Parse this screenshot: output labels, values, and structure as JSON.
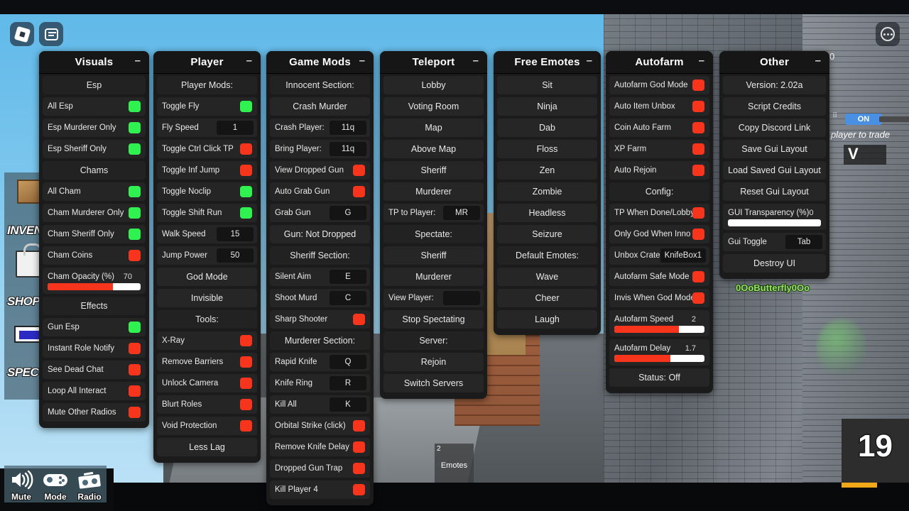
{
  "topbar": {
    "roblox_icon": "roblox-logo-icon",
    "chat_icon": "chat-icon",
    "menu_icon": "more-options-icon"
  },
  "side_menu": [
    {
      "label": "INVENTORY",
      "icon": "crate-icon"
    },
    {
      "label": "SHOP",
      "icon": "shopping-bag-icon"
    },
    {
      "label": "SPECTATE",
      "icon": "screen-icon"
    }
  ],
  "bottom_controls": [
    {
      "label": "Mute",
      "icon": "speaker-icon"
    },
    {
      "label": "Mode",
      "icon": "gamepad-icon"
    },
    {
      "label": "Radio",
      "icon": "radio-icon"
    }
  ],
  "hotbar": {
    "number": "2",
    "label": "Emotes"
  },
  "counter": {
    "value": "19"
  },
  "trade_panel": {
    "zero": "0",
    "toggle": "ON",
    "hint": "player to trade",
    "letter": "V"
  },
  "username_tag": "0OoButterfly0Oo",
  "minimize_glyph": "–",
  "panels": [
    {
      "title": "Visuals",
      "rows": [
        {
          "type": "section",
          "label": "Esp"
        },
        {
          "type": "toggle",
          "label": "All Esp",
          "state": "on"
        },
        {
          "type": "toggle",
          "label": "Esp Murderer Only",
          "state": "on"
        },
        {
          "type": "toggle",
          "label": "Esp Sheriff Only",
          "state": "on"
        },
        {
          "type": "section",
          "label": "Chams"
        },
        {
          "type": "toggle",
          "label": "All Cham",
          "state": "on"
        },
        {
          "type": "toggle",
          "label": "Cham Murderer Only",
          "state": "on"
        },
        {
          "type": "toggle",
          "label": "Cham Sheriff Only",
          "state": "on"
        },
        {
          "type": "toggle",
          "label": "Cham Coins",
          "state": "off"
        },
        {
          "type": "slider",
          "label": "Cham Opacity (%)",
          "value": "70",
          "percent": 70
        },
        {
          "type": "section",
          "label": "Effects"
        },
        {
          "type": "toggle",
          "label": "Gun Esp",
          "state": "on"
        },
        {
          "type": "toggle",
          "label": "Instant Role Notify",
          "state": "off"
        },
        {
          "type": "toggle",
          "label": "See Dead Chat",
          "state": "off"
        },
        {
          "type": "toggle",
          "label": "Loop All Interact",
          "state": "off"
        },
        {
          "type": "toggle",
          "label": "Mute Other Radios",
          "state": "off"
        }
      ]
    },
    {
      "title": "Player",
      "rows": [
        {
          "type": "section",
          "label": "Player Mods:"
        },
        {
          "type": "toggle",
          "label": "Toggle Fly",
          "state": "on"
        },
        {
          "type": "input",
          "label": "Fly Speed",
          "value": "1"
        },
        {
          "type": "toggle",
          "label": "Toggle Ctrl Click TP",
          "state": "off"
        },
        {
          "type": "toggle",
          "label": "Toggle Inf Jump",
          "state": "off"
        },
        {
          "type": "toggle",
          "label": "Toggle Noclip",
          "state": "on"
        },
        {
          "type": "toggle",
          "label": "Toggle Shift Run",
          "state": "on"
        },
        {
          "type": "input",
          "label": "Walk Speed",
          "value": "15"
        },
        {
          "type": "input",
          "label": "Jump Power",
          "value": "50"
        },
        {
          "type": "button",
          "label": "God Mode"
        },
        {
          "type": "button",
          "label": "Invisible"
        },
        {
          "type": "section",
          "label": "Tools:"
        },
        {
          "type": "toggle",
          "label": "X-Ray",
          "state": "off"
        },
        {
          "type": "toggle",
          "label": "Remove Barriers",
          "state": "off"
        },
        {
          "type": "toggle",
          "label": "Unlock Camera",
          "state": "off"
        },
        {
          "type": "toggle",
          "label": "Blurt Roles",
          "state": "off"
        },
        {
          "type": "toggle",
          "label": "Void Protection",
          "state": "off"
        },
        {
          "type": "button",
          "label": "Less Lag"
        }
      ]
    },
    {
      "title": "Game Mods",
      "rows": [
        {
          "type": "section",
          "label": "Innocent Section:"
        },
        {
          "type": "button",
          "label": "Crash Murder"
        },
        {
          "type": "input",
          "label": "Crash Player:",
          "value": "11q"
        },
        {
          "type": "input",
          "label": "Bring Player:",
          "value": "11q"
        },
        {
          "type": "toggle",
          "label": "View Dropped Gun",
          "state": "off"
        },
        {
          "type": "toggle",
          "label": "Auto Grab Gun",
          "state": "off"
        },
        {
          "type": "input",
          "label": "Grab Gun",
          "value": "G"
        },
        {
          "type": "status",
          "label": "Gun: Not Dropped"
        },
        {
          "type": "section",
          "label": "Sheriff Section:"
        },
        {
          "type": "input",
          "label": "Silent Aim",
          "value": "E"
        },
        {
          "type": "input",
          "label": "Shoot Murd",
          "value": "C"
        },
        {
          "type": "toggle",
          "label": "Sharp Shooter",
          "state": "off"
        },
        {
          "type": "section",
          "label": "Murderer Section:"
        },
        {
          "type": "input",
          "label": "Rapid Knife",
          "value": "Q"
        },
        {
          "type": "input",
          "label": "Knife Ring",
          "value": "R"
        },
        {
          "type": "input",
          "label": "Kill All",
          "value": "K"
        },
        {
          "type": "toggle",
          "label": "Orbital Strike (click)",
          "state": "off"
        },
        {
          "type": "toggle",
          "label": "Remove Knife Delay",
          "state": "off"
        },
        {
          "type": "toggle",
          "label": "Dropped Gun Trap",
          "state": "off"
        },
        {
          "type": "toggle",
          "label": "Kill Player 4",
          "state": "off"
        }
      ]
    },
    {
      "title": "Teleport",
      "rows": [
        {
          "type": "button",
          "label": "Lobby"
        },
        {
          "type": "button",
          "label": "Voting Room"
        },
        {
          "type": "button",
          "label": "Map"
        },
        {
          "type": "button",
          "label": "Above Map"
        },
        {
          "type": "button",
          "label": "Sheriff"
        },
        {
          "type": "button",
          "label": "Murderer"
        },
        {
          "type": "input",
          "label": "TP to Player:",
          "value": "MR"
        },
        {
          "type": "section",
          "label": "Spectate:"
        },
        {
          "type": "button",
          "label": "Sheriff"
        },
        {
          "type": "button",
          "label": "Murderer"
        },
        {
          "type": "input",
          "label": "View Player:",
          "value": ""
        },
        {
          "type": "button",
          "label": "Stop Spectating"
        },
        {
          "type": "section",
          "label": "Server:"
        },
        {
          "type": "button",
          "label": "Rejoin"
        },
        {
          "type": "button",
          "label": "Switch Servers"
        }
      ]
    },
    {
      "title": "Free Emotes",
      "rows": [
        {
          "type": "button",
          "label": "Sit"
        },
        {
          "type": "button",
          "label": "Ninja"
        },
        {
          "type": "button",
          "label": "Dab"
        },
        {
          "type": "button",
          "label": "Floss"
        },
        {
          "type": "button",
          "label": "Zen"
        },
        {
          "type": "button",
          "label": "Zombie"
        },
        {
          "type": "button",
          "label": "Headless"
        },
        {
          "type": "button",
          "label": "Seizure"
        },
        {
          "type": "section",
          "label": "Default Emotes:"
        },
        {
          "type": "button",
          "label": "Wave"
        },
        {
          "type": "button",
          "label": "Cheer"
        },
        {
          "type": "button",
          "label": "Laugh"
        }
      ]
    },
    {
      "title": "Autofarm",
      "rows": [
        {
          "type": "toggle",
          "label": "Autofarm God Mode",
          "state": "off"
        },
        {
          "type": "toggle",
          "label": "Auto Item Unbox",
          "state": "off"
        },
        {
          "type": "toggle",
          "label": "Coin Auto Farm",
          "state": "off"
        },
        {
          "type": "toggle",
          "label": "XP Farm",
          "state": "off"
        },
        {
          "type": "toggle",
          "label": "Auto Rejoin",
          "state": "off"
        },
        {
          "type": "section",
          "label": "Config:"
        },
        {
          "type": "toggle",
          "label": "TP When Done/Lobby",
          "state": "off"
        },
        {
          "type": "toggle",
          "label": "Only God When Inno",
          "state": "off"
        },
        {
          "type": "input",
          "label": "Unbox Crate:",
          "value": "KnifeBox1"
        },
        {
          "type": "toggle",
          "label": "Autofarm Safe Mode",
          "state": "off"
        },
        {
          "type": "toggle",
          "label": "Invis When God Mode",
          "state": "off"
        },
        {
          "type": "slider",
          "label": "Autofarm Speed",
          "value": "2",
          "percent": 72
        },
        {
          "type": "slider",
          "label": "Autofarm Delay",
          "value": "1.7",
          "percent": 62
        },
        {
          "type": "button",
          "label": "Status: Off"
        }
      ]
    },
    {
      "title": "Other",
      "rows": [
        {
          "type": "button",
          "label": "Version: 2.02a"
        },
        {
          "type": "button",
          "label": "Script Credits"
        },
        {
          "type": "button",
          "label": "Copy Discord Link"
        },
        {
          "type": "button",
          "label": "Save Gui Layout"
        },
        {
          "type": "button",
          "label": "Load Saved Gui Layout"
        },
        {
          "type": "button",
          "label": "Reset Gui Layout"
        },
        {
          "type": "slider",
          "label": "GUI Transparency (%)",
          "value": "0",
          "percent": 0
        },
        {
          "type": "input",
          "label": "Gui Toggle",
          "value": "Tab"
        },
        {
          "type": "button",
          "label": "Destroy UI"
        }
      ]
    }
  ],
  "colors": {
    "toggle_on": "#2ff150",
    "toggle_off": "#f7351d",
    "slider_fill": "#f7351d",
    "panel_bg": "#1b1b1b",
    "row_bg": "#252525",
    "status_red": "#e8443a",
    "accent_blue": "#4a90e2"
  }
}
